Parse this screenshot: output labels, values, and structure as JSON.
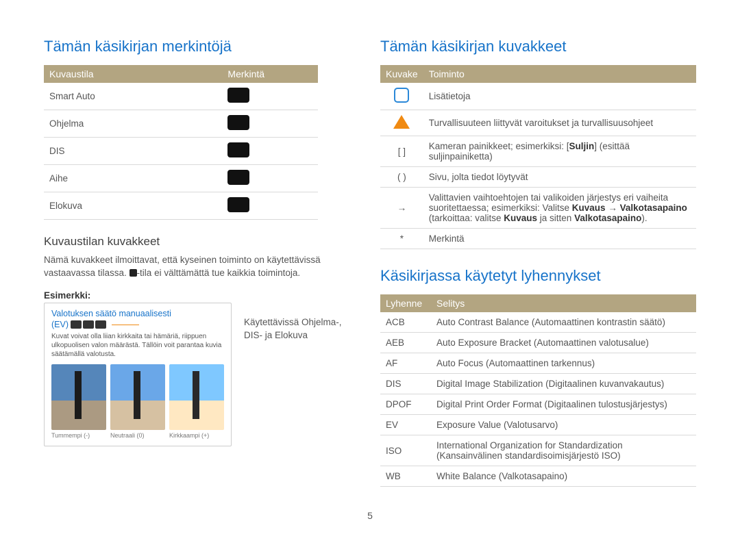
{
  "left": {
    "title": "Tämän käsikirjan merkintöjä",
    "table1": {
      "head": {
        "c1": "Kuvaustila",
        "c2": "Merkintä"
      },
      "rows": [
        {
          "mode": "Smart Auto"
        },
        {
          "mode": "Ohjelma"
        },
        {
          "mode": "DIS"
        },
        {
          "mode": "Aihe"
        },
        {
          "mode": "Elokuva"
        }
      ]
    },
    "sub_title": "Kuvaustilan kuvakkeet",
    "body1": "Nämä kuvakkeet ilmoittavat, että kyseinen toiminto on käytettävissä vastaavassa tilassa. ",
    "body1b": "-tila ei välttämättä tue kaikkia toimintoja.",
    "example_label": "Esimerkki:",
    "example": {
      "heading": "Valotuksen säätö manuaalisesti",
      "ev": "(EV)",
      "desc": "Kuvat voivat olla liian kirkkaita tai hämäriä, riippuen ulkopuolisen valon määrästä. Tällöin voit parantaa kuvia säätämällä valotusta.",
      "thumbs": [
        "Tummempi (-)",
        "Neutraali (0)",
        "Kirkkaampi (+)"
      ]
    },
    "example_right": "Käytettävissä Ohjelma-, DIS- ja Elokuva"
  },
  "right": {
    "title1": "Tämän käsikirjan kuvakkeet",
    "table2": {
      "head": {
        "c1": "Kuvake",
        "c2": "Toiminto"
      },
      "rows": [
        {
          "icon": "info",
          "text": "Lisätietoja"
        },
        {
          "icon": "warn",
          "text": "Turvallisuuteen liittyvät varoitukset ja turvallisuusohjeet"
        },
        {
          "icon": "[ ]",
          "text_a": "Kameran painikkeet; esimerkiksi: [",
          "text_b": "Suljin",
          "text_c": "] (esittää suljinpainiketta)"
        },
        {
          "icon": "( )",
          "text": "Sivu, jolta tiedot löytyvät"
        },
        {
          "icon": "→",
          "text_a": "Valittavien vaihtoehtojen tai valikoiden järjestys eri vaiheita suoritettaessa; esimerkiksi: Valitse ",
          "b1": "Kuvaus",
          "arrow": " → ",
          "b2": "Valkotasapaino",
          "text_b": " (tarkoittaa: valitse ",
          "b3": "Kuvaus",
          "text_c": " ja sitten ",
          "b4": "Valkotasapaino",
          "text_d": ")."
        },
        {
          "icon": "*",
          "text": "Merkintä"
        }
      ]
    },
    "title2": "Käsikirjassa käytetyt lyhennykset",
    "table3": {
      "head": {
        "c1": "Lyhenne",
        "c2": "Selitys"
      },
      "rows": [
        {
          "a": "ACB",
          "b": "Auto Contrast Balance (Automaattinen kontrastin säätö)"
        },
        {
          "a": "AEB",
          "b": "Auto Exposure Bracket (Automaattinen valotusalue)"
        },
        {
          "a": "AF",
          "b": "Auto Focus (Automaattinen tarkennus)"
        },
        {
          "a": "DIS",
          "b": "Digital Image Stabilization (Digitaalinen kuvanvakautus)"
        },
        {
          "a": "DPOF",
          "b": "Digital Print Order Format (Digitaalinen tulostusjärjestys)"
        },
        {
          "a": "EV",
          "b": "Exposure Value (Valotusarvo)"
        },
        {
          "a": "ISO",
          "b": "International Organization for Standardization (Kansainvälinen standardisoimisjärjestö ISO)"
        },
        {
          "a": "WB",
          "b": "White Balance (Valkotasapaino)"
        }
      ]
    }
  },
  "page_number": "5"
}
